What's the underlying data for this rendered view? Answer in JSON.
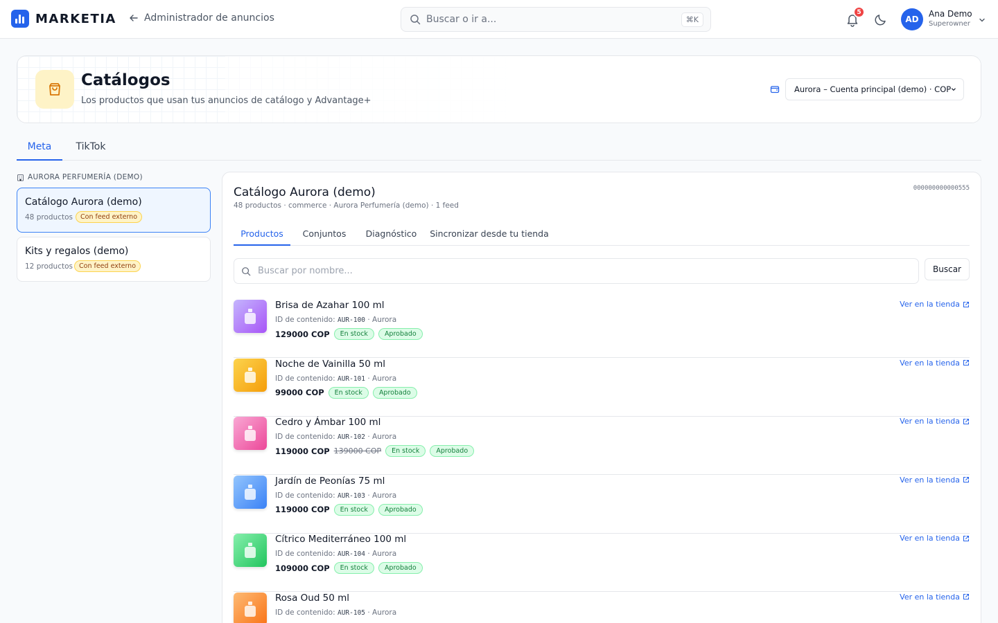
{
  "app": {
    "brand": "MARKETIA",
    "back_label": "Administrador de anuncios"
  },
  "search": {
    "placeholder": "Buscar o ir a...",
    "shortcut": "⌘K"
  },
  "notifications": {
    "count": "5"
  },
  "user": {
    "initials": "AD",
    "name": "Ana Demo",
    "role": "Superowner"
  },
  "header": {
    "title": "Catálogos",
    "subtitle": "Los productos que usan tus anuncios de catálogo y Advantage+",
    "account_selected": "Aurora – Cuenta principal (demo) · COP"
  },
  "platform_tabs": [
    {
      "label": "Meta",
      "active": true
    },
    {
      "label": "TikTok",
      "active": false
    }
  ],
  "sidebar": {
    "business_label": "AURORA PERFUMERÍA (DEMO)",
    "catalogs": [
      {
        "name": "Catálogo Aurora (demo)",
        "count": "48 productos",
        "badge": "Con feed externo",
        "active": true
      },
      {
        "name": "Kits y regalos (demo)",
        "count": "12 productos",
        "badge": "Con feed externo",
        "active": false
      }
    ]
  },
  "catalog": {
    "title": "Catálogo Aurora (demo)",
    "meta": "48 productos · commerce · Aurora Perfumería (demo) · 1 feed",
    "id": "000000000000555",
    "tabs": [
      {
        "label": "Productos",
        "active": true
      },
      {
        "label": "Conjuntos",
        "active": false
      },
      {
        "label": "Diagnóstico",
        "active": false
      },
      {
        "label": "Sincronizar desde tu tienda",
        "active": false
      }
    ],
    "search_placeholder": "Buscar por nombre...",
    "search_button": "Buscar",
    "id_label": "ID de contenido:",
    "store_link": "Ver en la tienda",
    "products": [
      {
        "name": "Brisa de Azahar 100 ml",
        "content_id": "AUR-100",
        "brand": "Aurora",
        "price": "129000 COP",
        "old_price": "",
        "stock": "En stock",
        "status": "Aprobado",
        "color_a": "#c4b5fd",
        "color_b": "#a855f7"
      },
      {
        "name": "Noche de Vainilla 50 ml",
        "content_id": "AUR-101",
        "brand": "Aurora",
        "price": "99000 COP",
        "old_price": "",
        "stock": "En stock",
        "status": "Aprobado",
        "color_a": "#fcd34d",
        "color_b": "#f59e0b"
      },
      {
        "name": "Cedro y Ámbar 100 ml",
        "content_id": "AUR-102",
        "brand": "Aurora",
        "price": "119000 COP",
        "old_price": "139000 COP",
        "stock": "En stock",
        "status": "Aprobado",
        "color_a": "#f9a8d4",
        "color_b": "#ec4899"
      },
      {
        "name": "Jardín de Peonías 75 ml",
        "content_id": "AUR-103",
        "brand": "Aurora",
        "price": "119000 COP",
        "old_price": "",
        "stock": "En stock",
        "status": "Aprobado",
        "color_a": "#93c5fd",
        "color_b": "#3b82f6"
      },
      {
        "name": "Cítrico Mediterráneo 100 ml",
        "content_id": "AUR-104",
        "brand": "Aurora",
        "price": "109000 COP",
        "old_price": "",
        "stock": "En stock",
        "status": "Aprobado",
        "color_a": "#86efac",
        "color_b": "#22c55e"
      },
      {
        "name": "Rosa Oud 50 ml",
        "content_id": "AUR-105",
        "brand": "Aurora",
        "price": "",
        "old_price": "",
        "stock": "",
        "status": "",
        "color_a": "#fdba74",
        "color_b": "#f97316"
      }
    ]
  }
}
